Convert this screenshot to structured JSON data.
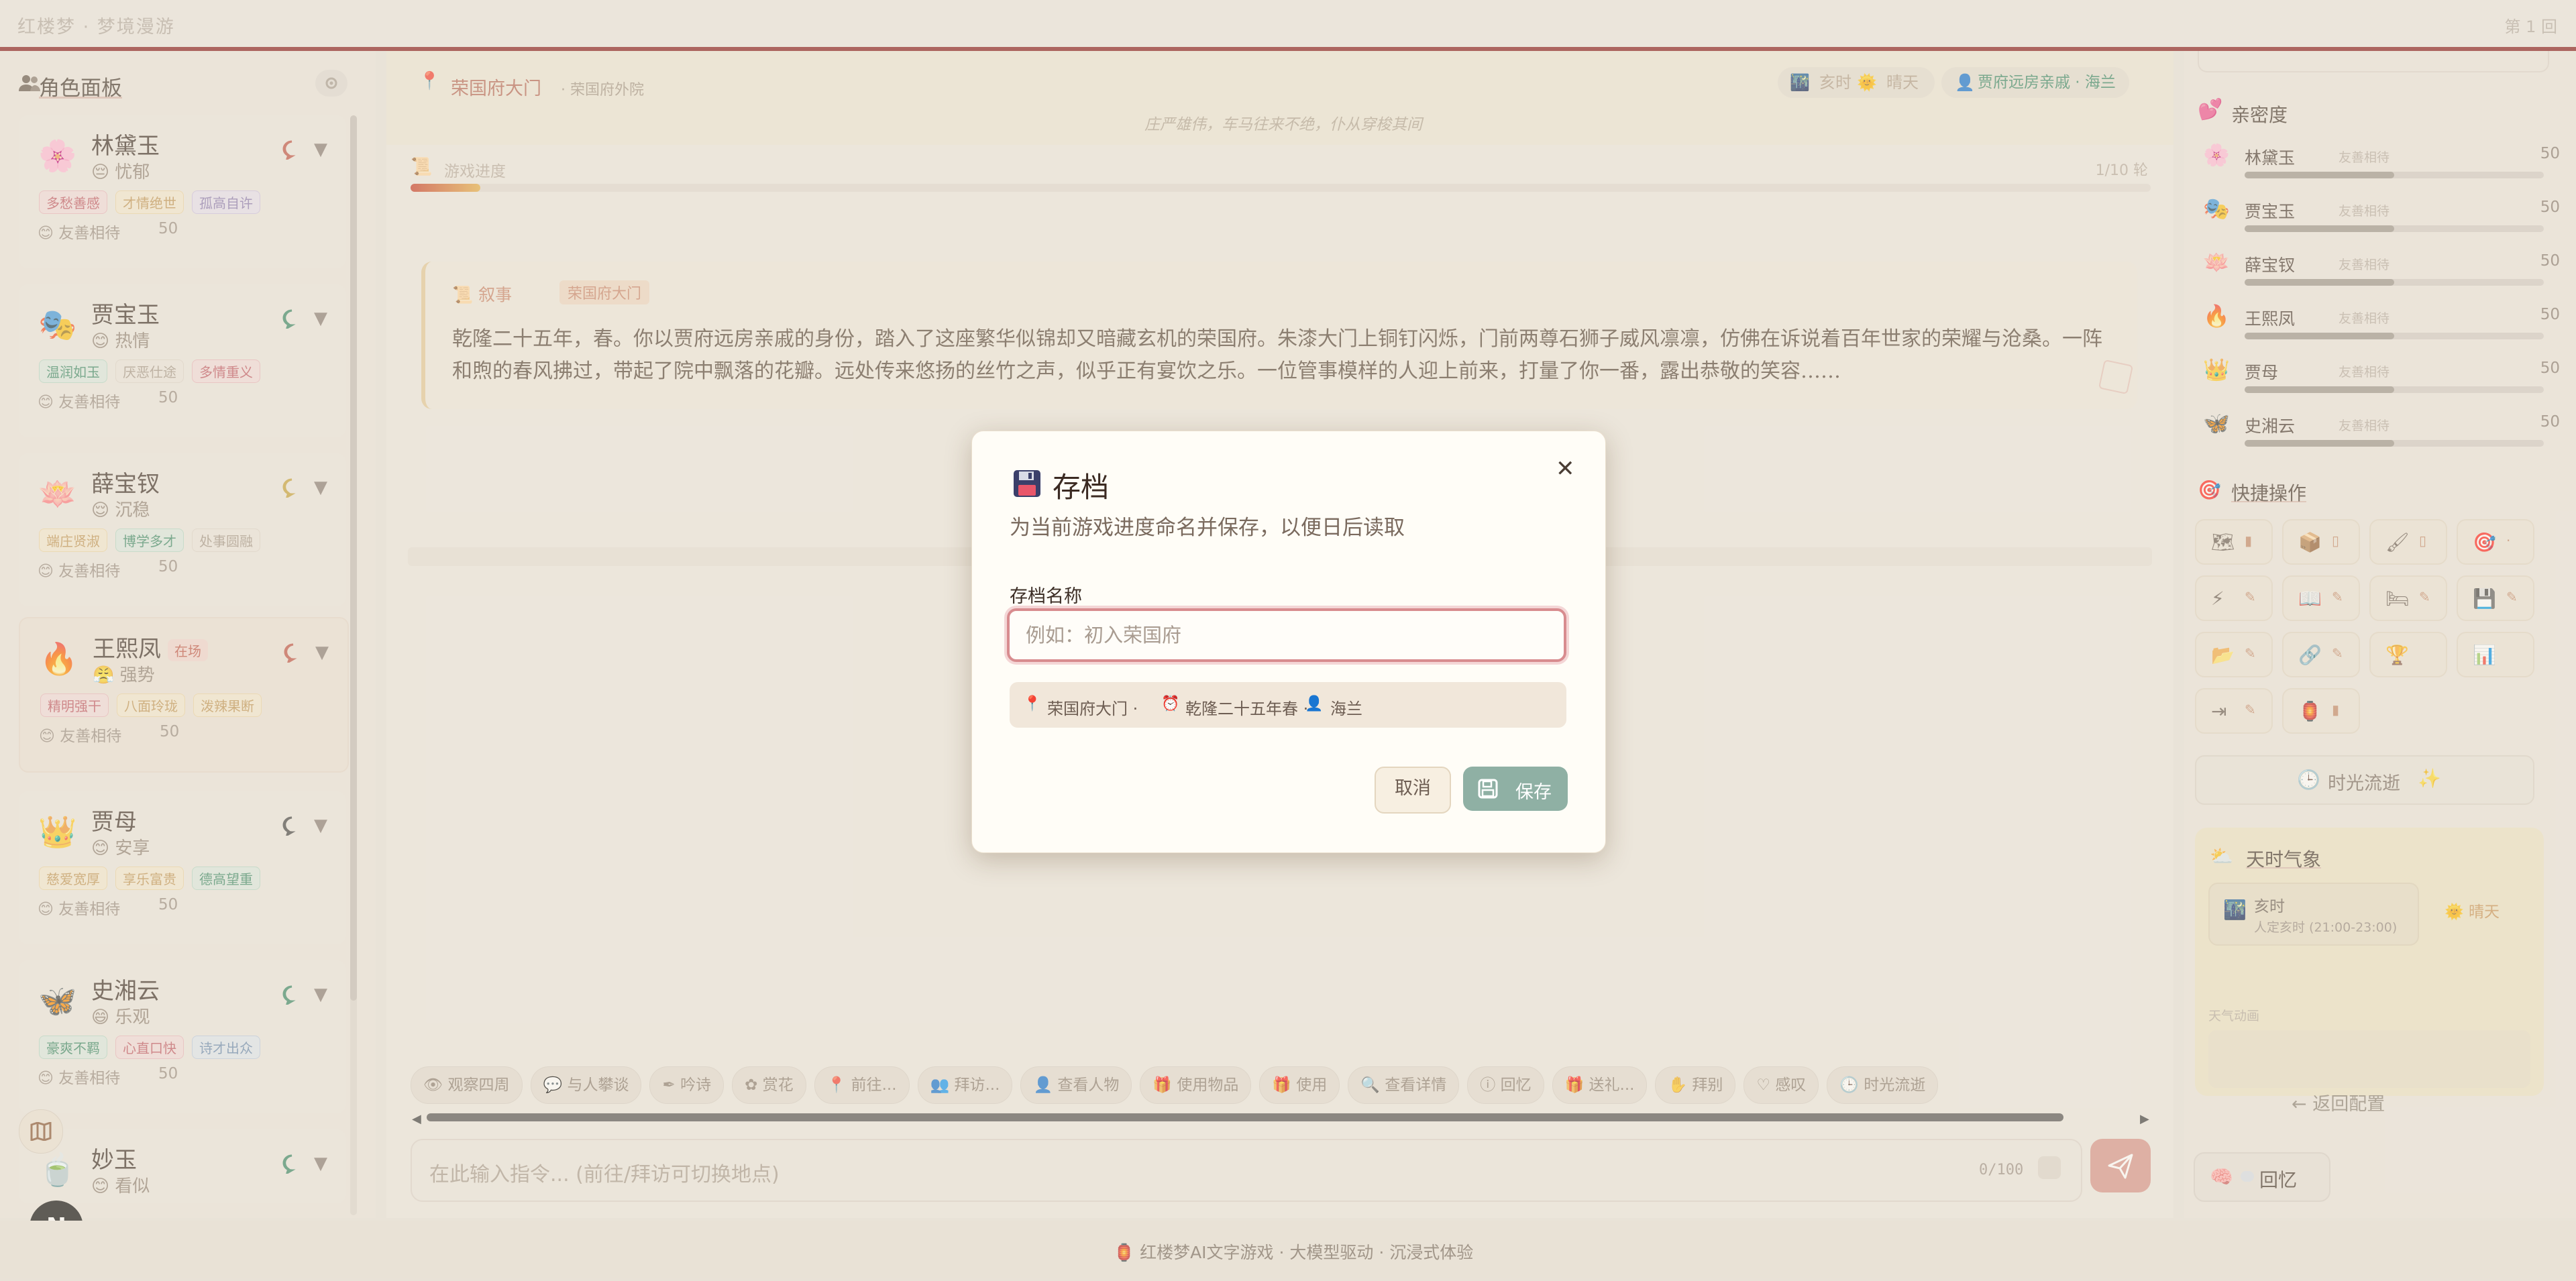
{
  "topbar": {
    "brand": "红楼梦 · 梦境漫游",
    "turn": "第 1 回"
  },
  "left_panel": {
    "title": "角色面板",
    "characters": [
      {
        "name": "林黛玉",
        "mood": "忧郁",
        "emoji": "🌸",
        "badge": "",
        "tags": [
          "多愁善感",
          "才情绝世",
          "孤高自许"
        ],
        "relation": "友善相待",
        "affection": "50"
      },
      {
        "name": "贾宝玉",
        "mood": "热情",
        "emoji": "🎭",
        "badge": "",
        "tags": [
          "温润如玉",
          "厌恶仕途",
          "多情重义"
        ],
        "relation": "友善相待",
        "affection": "50"
      },
      {
        "name": "薛宝钗",
        "mood": "沉稳",
        "emoji": "🪷",
        "badge": "",
        "tags": [
          "端庄贤淑",
          "博学多才",
          "处事圆融"
        ],
        "relation": "友善相待",
        "affection": "50"
      },
      {
        "name": "王熙凤",
        "mood": "强势",
        "emoji": "🔥",
        "badge": "在场",
        "tags": [
          "精明强干",
          "八面玲珑",
          "泼辣果断"
        ],
        "relation": "友善相待",
        "affection": "50"
      },
      {
        "name": "贾母",
        "mood": "安享",
        "emoji": "👑",
        "badge": "",
        "tags": [
          "慈爱宽厚",
          "享乐富贵",
          "德高望重"
        ],
        "relation": "友善相待",
        "affection": "50"
      },
      {
        "name": "史湘云",
        "mood": "乐观",
        "emoji": "🦋",
        "badge": "",
        "tags": [
          "豪爽不羁",
          "心直口快",
          "诗才出众"
        ],
        "relation": "友善相待",
        "affection": "50"
      },
      {
        "name": "妙玉",
        "mood": "看似",
        "emoji": "🍵",
        "badge": "",
        "tags": [],
        "relation": "",
        "affection": ""
      }
    ]
  },
  "location": {
    "name": "荣国府大门",
    "sub": "· 荣国府外院",
    "desc": "庄严雄伟，车马往来不绝，仆从穿梭其间",
    "time_pill": "亥时",
    "weather_pill": "晴天",
    "identity": "贾府远房亲戚 · 海兰"
  },
  "progress": {
    "label": "游戏进度",
    "count": "1/10 轮",
    "fraction": 0.04
  },
  "narrative": {
    "tag": "叙事",
    "loc": "荣国府大门",
    "text": "乾隆二十五年，春。你以贾府远房亲戚的身份，踏入了这座繁华似锦却又暗藏玄机的荣国府。朱漆大门上铜钉闪烁，门前两尊石狮子威风凛凛，仿佛在诉说着百年世家的荣耀与沧桑。一阵和煦的春风拂过，带起了院中飘落的花瓣。远处传来悠扬的丝竹之声，似乎正有宴饮之乐。一位管事模样的人迎上前来，打量了你一番，露出恭敬的笑容……"
  },
  "actions": [
    "观察四周",
    "与人攀谈",
    "吟诗",
    "赏花",
    "前往...",
    "拜访...",
    "查看人物",
    "使用物品",
    "使用",
    "查看详情",
    "回忆",
    "送礼...",
    "拜别",
    "感叹",
    "时光流逝"
  ],
  "input": {
    "placeholder": "在此输入指令... (前往/拜访可切换地点)",
    "count": "0/100"
  },
  "right_panel": {
    "affection_title": "亲密度",
    "affection": [
      {
        "name": "林黛玉",
        "desc": "友善相待",
        "value": "50",
        "icon": "🌸"
      },
      {
        "name": "贾宝玉",
        "desc": "友善相待",
        "value": "50",
        "icon": "🎭"
      },
      {
        "name": "薛宝钗",
        "desc": "友善相待",
        "value": "50",
        "icon": "🪷"
      },
      {
        "name": "王熙凤",
        "desc": "友善相待",
        "value": "50",
        "icon": "🔥"
      },
      {
        "name": "贾母",
        "desc": "友善相待",
        "value": "50",
        "icon": "👑"
      },
      {
        "name": "史湘云",
        "desc": "友善相待",
        "value": "50",
        "icon": "🦋"
      }
    ],
    "quick_title": "快捷操作",
    "time_flow": "时光流逝",
    "weather_title": "天时气象",
    "weather_time": "亥时",
    "weather_time_sub": "人定亥时 (21:00-23:00)",
    "weather_state": "晴天",
    "weather_anim": "天气动画",
    "back": "返回配置",
    "recall": "回忆"
  },
  "footer": {
    "text": "红楼梦AI文字游戏 · 大模型驱动 · 沉浸式体验"
  },
  "modal": {
    "title": "存档",
    "desc": "为当前游戏进度命名并保存，以便日后读取",
    "label": "存档名称",
    "placeholder": "例如：初入荣国府",
    "info_loc": "荣国府大门 ·",
    "info_time": "乾隆二十五年春 ·",
    "info_name": "海兰",
    "cancel": "取消",
    "save": "保存"
  },
  "colors": {
    "accent_red": "#8a2222",
    "save_green": "#8fb0a4",
    "input_border": "#d88c8f"
  }
}
